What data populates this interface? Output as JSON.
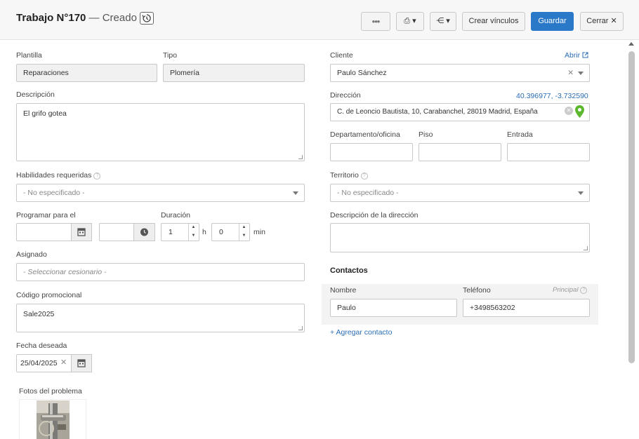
{
  "header": {
    "title": "Trabajo N°170",
    "status": "— Creado",
    "more_label": "•••",
    "print_label": "⎙ ▾",
    "share_label": "⋲ ▾",
    "create_links_label": "Crear vínculos",
    "save_label": "Guardar",
    "close_label": "Cerrar ✕"
  },
  "left": {
    "template_label": "Plantilla",
    "template_value": "Reparaciones",
    "type_label": "Tipo",
    "type_value": "Plomería",
    "description_label": "Descripción",
    "description_value": "El grifo gotea",
    "skills_label": "Habilidades requeridas",
    "skills_value": "- No especificado -",
    "schedule_label": "Programar para el",
    "duration_label": "Duración",
    "duration_hours": "1",
    "hours_unit": "h",
    "duration_minutes": "0",
    "minutes_unit": "min",
    "assigned_label": "Asignado",
    "assigned_placeholder": "- Seleccionar cesionario -",
    "promo_label": "Código promocional",
    "promo_value": "Sale2025",
    "desired_date_label": "Fecha deseada",
    "desired_date_value": "25/04/2025",
    "photos_label": "Fotos del problema"
  },
  "right": {
    "client_label": "Cliente",
    "open_link": "Abrir",
    "client_value": "Paulo Sánchez",
    "address_label": "Dirección",
    "coordinates": "40.396977, -3.732590",
    "address_value": "C. de Leoncio Bautista, 10, Carabanchel, 28019 Madrid, España",
    "department_label": "Departamento/oficina",
    "floor_label": "Piso",
    "entrance_label": "Entrada",
    "territory_label": "Territorio",
    "territory_value": "- No especificado -",
    "address_desc_label": "Descripción de la dirección",
    "contacts_title": "Contactos",
    "name_col": "Nombre",
    "phone_col": "Teléfono",
    "principal_label": "Principal",
    "contact_name": "Paulo",
    "contact_phone": "+3498563202",
    "add_contact": "+ Agregar contacto"
  },
  "colors": {
    "primary": "#2a79c9",
    "link": "#2a6db5",
    "map_pin": "#5cb82e"
  }
}
